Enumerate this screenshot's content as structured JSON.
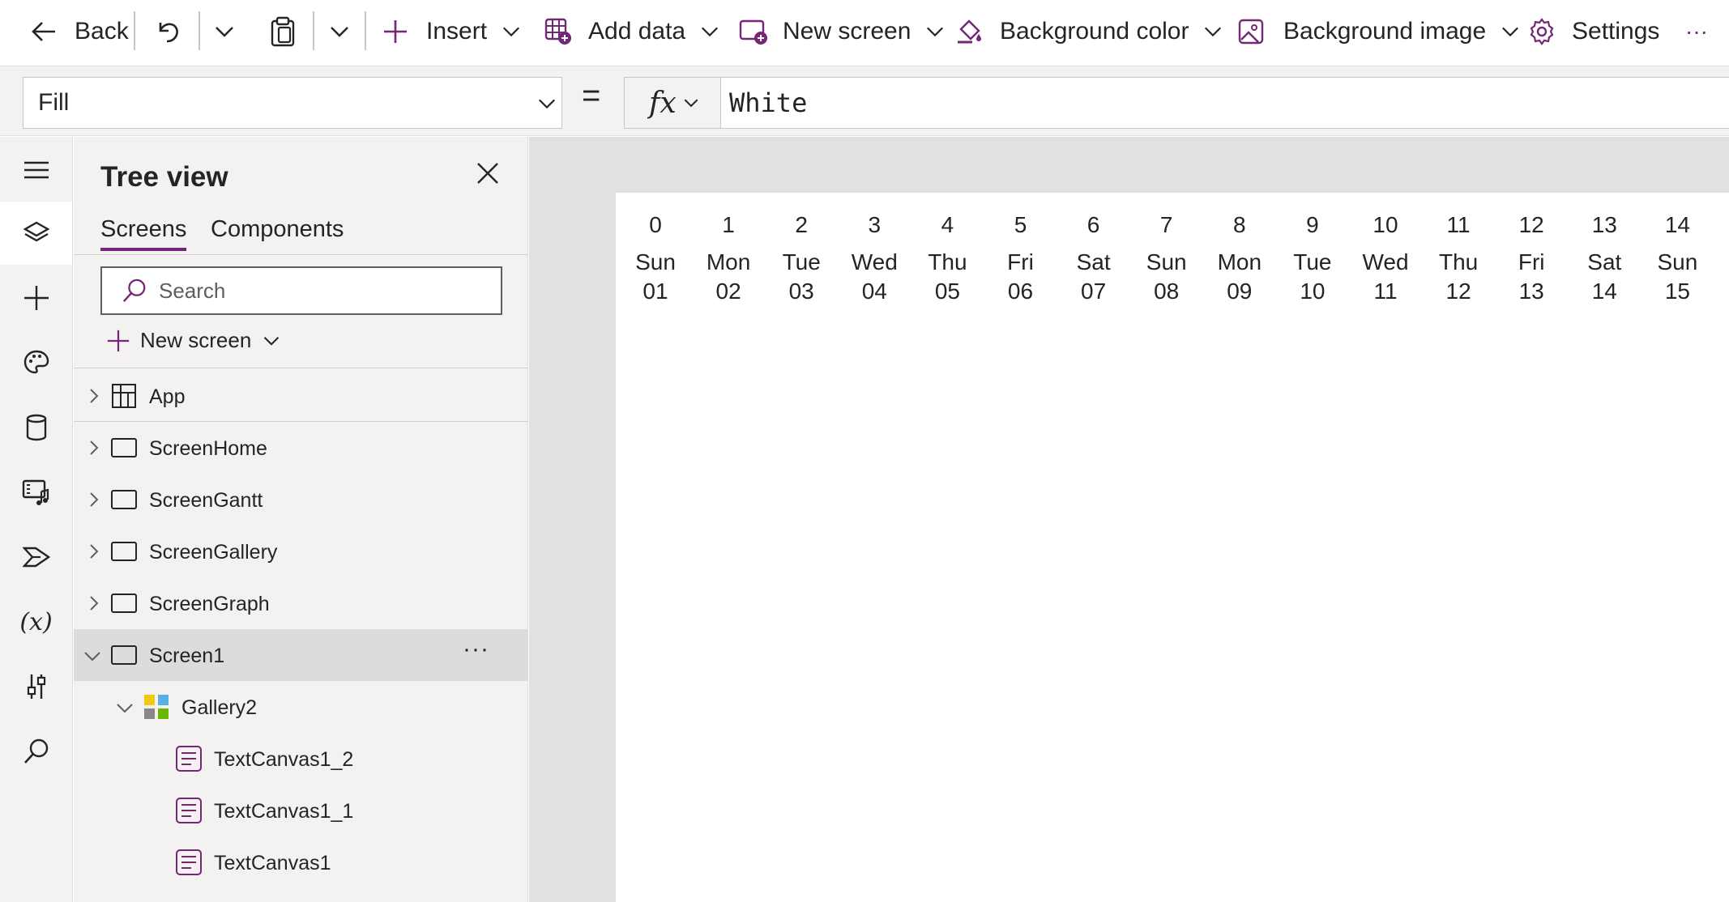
{
  "toolbar": {
    "back_label": "Back",
    "insert_label": "Insert",
    "add_data_label": "Add data",
    "new_screen_label": "New screen",
    "background_color_label": "Background color",
    "background_image_label": "Background image",
    "settings_label": "Settings",
    "more_label": "···"
  },
  "formula_bar": {
    "property": "Fill",
    "equals": "=",
    "fx_label": "fx",
    "formula": "White"
  },
  "tree_view": {
    "title": "Tree view",
    "tabs": [
      {
        "label": "Screens",
        "active": true
      },
      {
        "label": "Components",
        "active": false
      }
    ],
    "search_placeholder": "Search",
    "new_screen_label": "New screen",
    "items": [
      {
        "label": "App",
        "type": "app",
        "expanded": false
      },
      {
        "label": "ScreenHome",
        "type": "screen",
        "expanded": false
      },
      {
        "label": "ScreenGantt",
        "type": "screen",
        "expanded": false
      },
      {
        "label": "ScreenGallery",
        "type": "screen",
        "expanded": false
      },
      {
        "label": "ScreenGraph",
        "type": "screen",
        "expanded": false
      },
      {
        "label": "Screen1",
        "type": "screen",
        "expanded": true,
        "selected": true,
        "more": "···"
      },
      {
        "label": "Gallery2",
        "type": "gallery",
        "expanded": true
      },
      {
        "label": "TextCanvas1_2",
        "type": "text"
      },
      {
        "label": "TextCanvas1_1",
        "type": "text"
      },
      {
        "label": "TextCanvas1",
        "type": "text"
      }
    ]
  },
  "gallery": {
    "columns": [
      {
        "num": "0",
        "day": "Sun",
        "date": "01"
      },
      {
        "num": "1",
        "day": "Mon",
        "date": "02"
      },
      {
        "num": "2",
        "day": "Tue",
        "date": "03"
      },
      {
        "num": "3",
        "day": "Wed",
        "date": "04"
      },
      {
        "num": "4",
        "day": "Thu",
        "date": "05"
      },
      {
        "num": "5",
        "day": "Fri",
        "date": "06"
      },
      {
        "num": "6",
        "day": "Sat",
        "date": "07"
      },
      {
        "num": "7",
        "day": "Sun",
        "date": "08"
      },
      {
        "num": "8",
        "day": "Mon",
        "date": "09"
      },
      {
        "num": "9",
        "day": "Tue",
        "date": "10"
      },
      {
        "num": "10",
        "day": "Wed",
        "date": "11"
      },
      {
        "num": "11",
        "day": "Thu",
        "date": "12"
      },
      {
        "num": "12",
        "day": "Fri",
        "date": "13"
      },
      {
        "num": "13",
        "day": "Sat",
        "date": "14"
      },
      {
        "num": "14",
        "day": "Sun",
        "date": "15"
      }
    ]
  },
  "colors": {
    "accent": "#742774",
    "rail_bg": "#f3f2f1",
    "canvas_bg": "#e1e1e1",
    "selected_row": "#dcdcdc"
  }
}
